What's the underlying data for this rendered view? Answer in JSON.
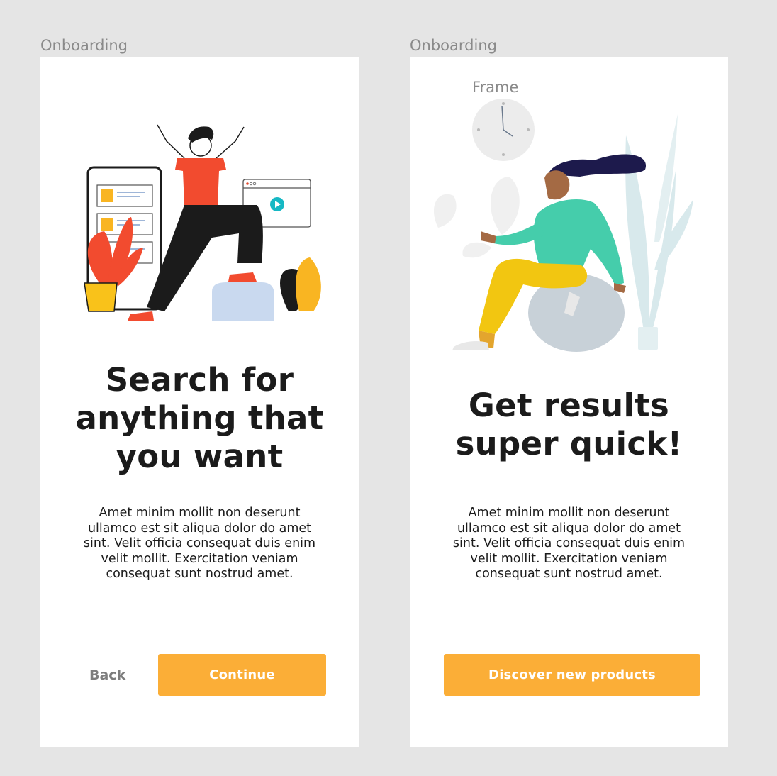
{
  "frames": [
    {
      "label": "Onboarding",
      "headline": "Search for anything that you want",
      "headline_lines": [
        "Search for",
        "anything that",
        "you want"
      ],
      "body": "Amet minim mollit non deserunt ullamco est sit aliqua dolor do amet sint. Velit officia consequat duis enim velit mollit. Exercitation veniam consequat sunt nostrud amet.",
      "body_lines": [
        "Amet minim mollit non deserunt",
        "ullamco est sit aliqua dolor do amet",
        "sint. Velit officia consequat duis enim",
        "velit mollit. Exercitation veniam",
        "consequat sunt nostrud amet."
      ],
      "back_label": "Back",
      "primary_label": "Continue"
    },
    {
      "label": "Onboarding",
      "inner_label": "Frame",
      "headline_lines": [
        "Get results",
        "super quick!"
      ],
      "body_lines": [
        "Amet minim mollit non deserunt",
        "ullamco est sit aliqua dolor do amet",
        "sint. Velit officia consequat duis enim",
        "velit mollit. Exercitation veniam",
        "consequat sunt nostrud amet."
      ],
      "primary_label": "Discover new products"
    }
  ],
  "colors": {
    "accent": "#fbae37",
    "canvas": "#e5e5e5",
    "text": "#1b1b1b"
  }
}
